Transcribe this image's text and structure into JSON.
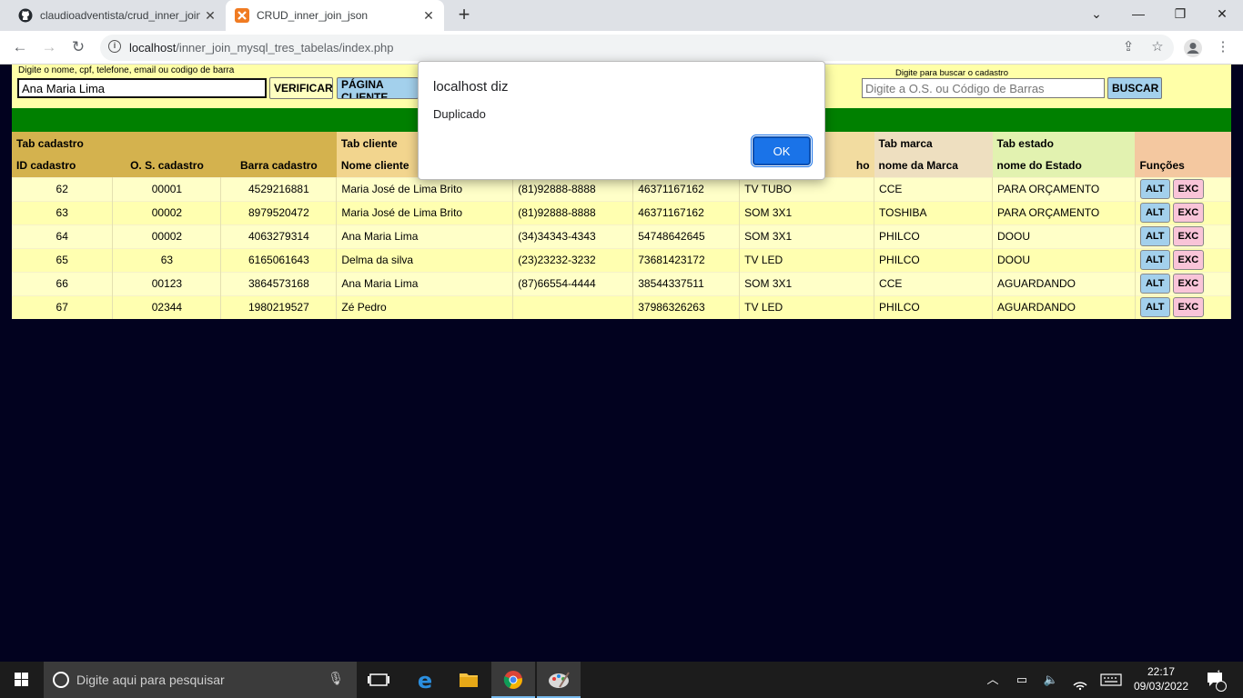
{
  "browser": {
    "tabs": [
      {
        "title": "claudioadventista/crud_inner_join",
        "close": "✕"
      },
      {
        "title": "CRUD_inner_join_json",
        "close": "✕"
      }
    ],
    "new_tab": "+",
    "url_host": "localhost",
    "url_path": "/inner_join_mysql_tres_tabelas/index.php",
    "window_controls": {
      "minimize": "—",
      "restore": "❐",
      "close": "✕",
      "tab_search": "⌄"
    }
  },
  "page": {
    "search_hint": "Digite o nome, cpf, telefone, email ou codigo de barra",
    "search_value": "Ana Maria Lima",
    "verify_button": "VERIFICAR",
    "client_page_button": "PÁGINA CLIENTE",
    "lookup_hint": "Digite para buscar o cadastro",
    "lookup_placeholder": "Digite a O.S. ou Código de Barras",
    "lookup_button": "BUSCAR",
    "group_headers": {
      "cadastro": "Tab cadastro",
      "cliente": "Tab cliente",
      "marca": "Tab marca",
      "estado": "Tab estado"
    },
    "column_headers": {
      "id": "ID cadastro",
      "os": "O. S. cadastro",
      "barra": "Barra cadastro",
      "nome": "Nome cliente",
      "aparelho_tail": "ho",
      "marca": "nome da Marca",
      "estado": "nome do Estado",
      "funcoes": "Funções"
    },
    "rows": [
      {
        "id": "62",
        "os": "00001",
        "barra": "4529216881",
        "nome": "Maria José de Lima Brito",
        "telefone": "(81)92888-8888",
        "cpf": "46371167162",
        "aparelho": "TV TUBO",
        "marca": "CCE",
        "estado": "PARA ORÇAMENTO"
      },
      {
        "id": "63",
        "os": "00002",
        "barra": "8979520472",
        "nome": "Maria José de Lima Brito",
        "telefone": "(81)92888-8888",
        "cpf": "46371167162",
        "aparelho": "SOM 3X1",
        "marca": "TOSHIBA",
        "estado": "PARA ORÇAMENTO"
      },
      {
        "id": "64",
        "os": "00002",
        "barra": "4063279314",
        "nome": "Ana Maria Lima",
        "telefone": "(34)34343-4343",
        "cpf": "54748642645",
        "aparelho": "SOM 3X1",
        "marca": "PHILCO",
        "estado": "DOOU"
      },
      {
        "id": "65",
        "os": "63",
        "barra": "6165061643",
        "nome": "Delma da silva",
        "telefone": "(23)23232-3232",
        "cpf": "73681423172",
        "aparelho": "TV LED",
        "marca": "PHILCO",
        "estado": "DOOU"
      },
      {
        "id": "66",
        "os": "00123",
        "barra": "3864573168",
        "nome": "Ana Maria Lima",
        "telefone": "(87)66554-4444",
        "cpf": "38544337511",
        "aparelho": "SOM 3X1",
        "marca": "CCE",
        "estado": "AGUARDANDO"
      },
      {
        "id": "67",
        "os": "02344",
        "barra": "1980219527",
        "nome": "Zé Pedro",
        "telefone": "",
        "cpf": "37986326263",
        "aparelho": "TV LED",
        "marca": "PHILCO",
        "estado": "AGUARDANDO"
      }
    ],
    "row_actions": {
      "alt": "ALT",
      "exc": "EXC"
    }
  },
  "dialog": {
    "title": "localhost diz",
    "message": "Duplicado",
    "ok": "OK"
  },
  "taskbar": {
    "search_placeholder": "Digite aqui para pesquisar",
    "time": "22:17",
    "date": "09/03/2022",
    "notification_count": "1"
  },
  "colors": {
    "page_bg": "#02021f",
    "form_bg": "#ffffa8",
    "green_bar": "#008000",
    "dialog_ok": "#1a73e8"
  }
}
